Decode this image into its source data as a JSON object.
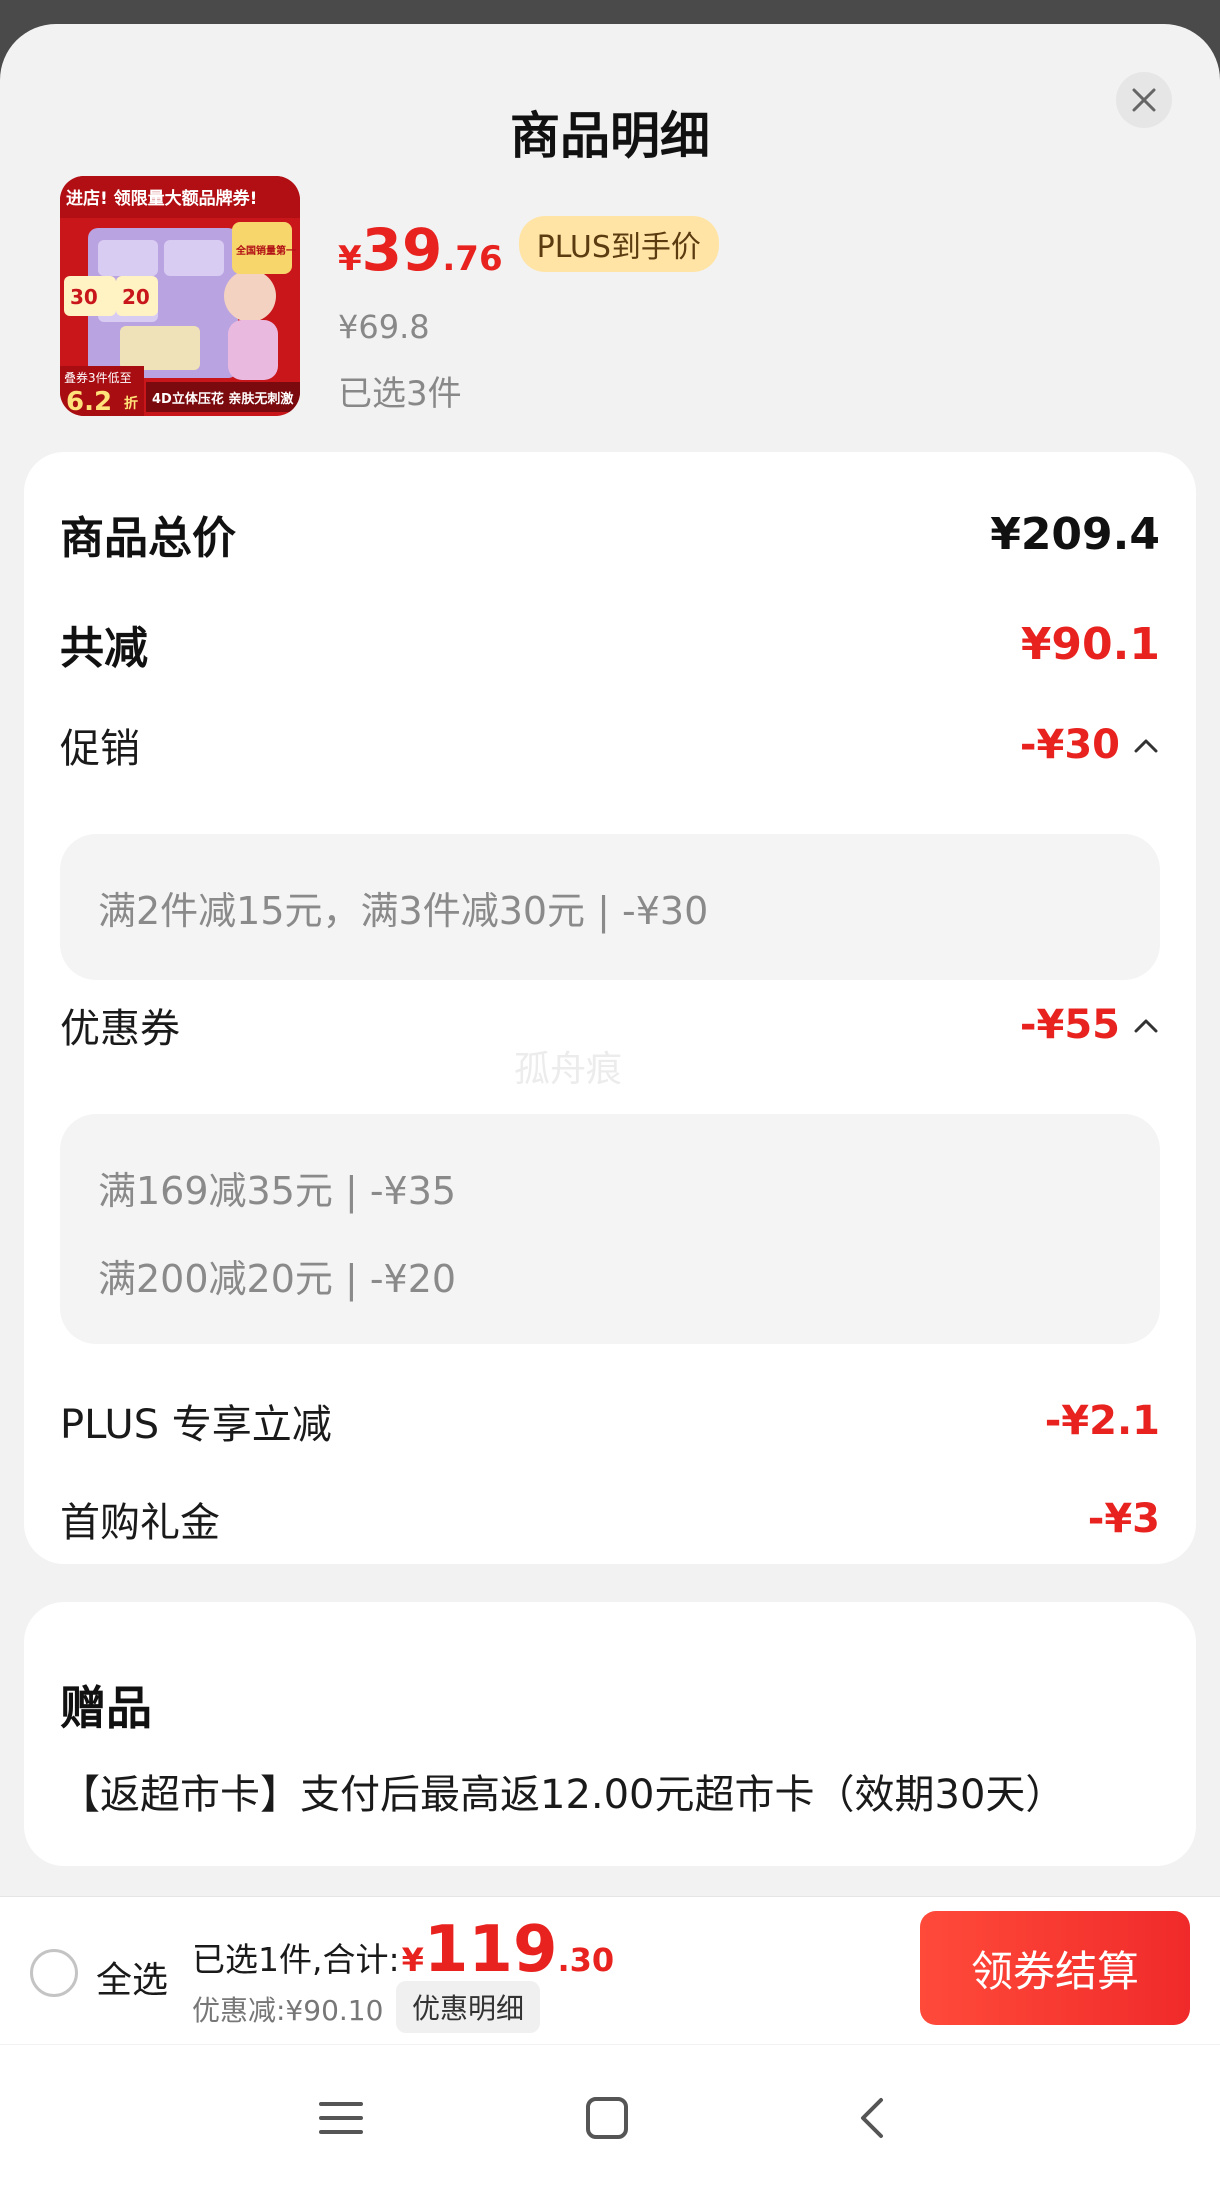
{
  "sheet": {
    "title": "商品明细"
  },
  "product": {
    "price_symbol": "¥",
    "price_int": "39",
    "price_dec": ".76",
    "plus_badge": "PLUS到手价",
    "original_price": "¥69.8",
    "selected": "已选3件",
    "image": {
      "top_banner": "进店! 领限量大额品牌券!",
      "side_badge": "全国销量第一",
      "coupon_a": "30",
      "coupon_b": "20",
      "bottom_left": "叠券3件低至",
      "bottom_big": "6.2",
      "bottom_unit": "折",
      "slogan": "4D立体压花 亲肤无刺激"
    }
  },
  "summary": {
    "total_label": "商品总价",
    "total_value": "¥209.4",
    "reduce_label": "共减",
    "reduce_value": "¥90.1",
    "promo_label": "促销",
    "promo_value": "-¥30",
    "promo_details": [
      "满2件减15元，满3件减30元 | -¥30"
    ],
    "coupon_label": "优惠券",
    "coupon_value": "-¥55",
    "coupon_details": [
      "满169减35元 | -¥35",
      "满200减20元 | -¥20"
    ],
    "plus_label": "PLUS 专享立减",
    "plus_value": "-¥2.1",
    "first_label": "首购礼金",
    "first_value": "-¥3",
    "watermark": "孤舟痕"
  },
  "gift": {
    "title": "赠品",
    "text": "【返超市卡】支付后最高返12.00元超市卡（效期30天）"
  },
  "bottom": {
    "select_all": "全选",
    "sum_label": "已选1件,合计:",
    "sum_symbol": "¥",
    "sum_int": "119",
    "sum_dec": ".30",
    "saved": "优惠减:¥90.10",
    "detail_button": "优惠明细",
    "checkout_button": "领券结算"
  },
  "colors": {
    "accent_red": "#e8231f",
    "plus_gold": "#ffe4a6"
  },
  "icons": [
    "close-icon",
    "chevron-up-icon",
    "menu-icon",
    "home-icon",
    "back-icon"
  ]
}
